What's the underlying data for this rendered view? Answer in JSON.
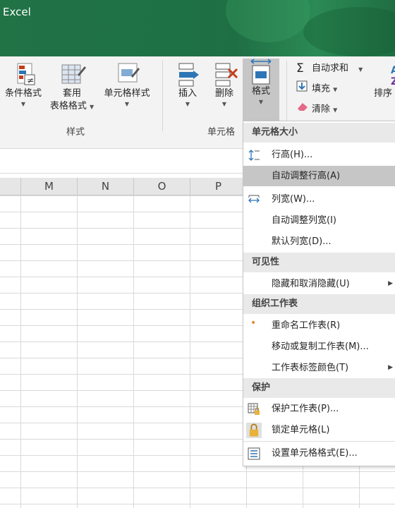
{
  "app": {
    "title": "Excel"
  },
  "ribbon": {
    "conditional_format": "条件格式",
    "table_format_1": "套用",
    "table_format_2": "表格格式",
    "cell_styles": "单元格样式",
    "styles_group": "样式",
    "insert": "插入",
    "delete": "删除",
    "format": "格式",
    "cells_group": "单元格",
    "autosum": "自动求和",
    "fill": "填充",
    "clear": "清除",
    "sort": "排序"
  },
  "columns": [
    "M",
    "N",
    "O",
    "P"
  ],
  "menu": {
    "section_cell_size": "单元格大小",
    "row_height": "行高(H)...",
    "autofit_row_height": "自动调整行高(A)",
    "column_width": "列宽(W)...",
    "autofit_column_width": "自动调整列宽(I)",
    "default_width": "默认列宽(D)...",
    "section_visibility": "可见性",
    "hide_unhide": "隐藏和取消隐藏(U)",
    "section_organize": "组织工作表",
    "rename_sheet": "重命名工作表(R)",
    "move_copy_sheet": "移动或复制工作表(M)...",
    "tab_color": "工作表标签颜色(T)",
    "section_protection": "保护",
    "protect_sheet": "保护工作表(P)...",
    "lock_cell": "锁定单元格(L)",
    "format_cells": "设置单元格格式(E)..."
  },
  "colors": {
    "excel_green": "#217346",
    "hover": "#c6c6c6"
  }
}
